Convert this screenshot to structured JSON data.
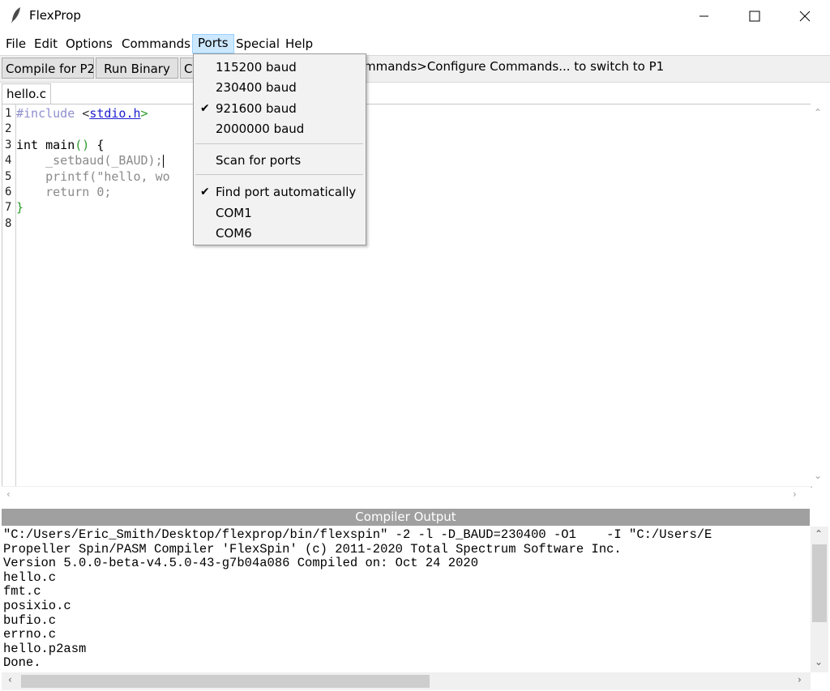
{
  "window": {
    "title": "FlexProp",
    "icon": "feather-icon",
    "controls": [
      "minimize-icon",
      "maximize-icon",
      "close-icon"
    ]
  },
  "menubar": {
    "items": [
      "File",
      "Edit",
      "Options",
      "Commands",
      "Ports",
      "Special",
      "Help"
    ],
    "active": "Ports"
  },
  "toolbar": {
    "compile_label": "Compile for P2",
    "run_label": "Run Binary",
    "third_label": "Co",
    "status": "mmands>Configure Commands... to switch to P1"
  },
  "tabs": [
    {
      "label": "hello.c"
    }
  ],
  "editor": {
    "line_numbers": [
      "1",
      "2",
      "3",
      "4",
      "5",
      "6",
      "7",
      "8"
    ],
    "lines": [
      {
        "a": "#include ",
        "b": "<",
        "c": "stdio.h",
        "d": ">"
      },
      {
        "text": ""
      },
      {
        "a": "int main",
        "b": "()",
        "c": " {"
      },
      {
        "text": "    _setbaud(_BAUD);"
      },
      {
        "text": "    printf(\"hello, wo"
      },
      {
        "text": "    return 0;"
      },
      {
        "text": "}"
      },
      {
        "text": ""
      }
    ]
  },
  "output": {
    "header": "Compiler Output",
    "lines": [
      "\"C:/Users/Eric_Smith/Desktop/flexprop/bin/flexspin\" -2 -l -D_BAUD=230400 -O1    -I \"C:/Users/E",
      "Propeller Spin/PASM Compiler 'FlexSpin' (c) 2011-2020 Total Spectrum Software Inc.",
      "Version 5.0.0-beta-v4.5.0-43-g7b04a086 Compiled on: Oct 24 2020",
      "hello.c",
      "fmt.c",
      "posixio.c",
      "bufio.c",
      "errno.c",
      "hello.p2asm",
      "Done."
    ]
  },
  "ports_menu": {
    "baud_items": [
      {
        "label": "115200 baud",
        "checked": false
      },
      {
        "label": "230400 baud",
        "checked": false
      },
      {
        "label": "921600 baud",
        "checked": true
      },
      {
        "label": "2000000 baud",
        "checked": false
      }
    ],
    "scan_label": "Scan for ports",
    "port_items": [
      {
        "label": "Find port automatically",
        "checked": true
      },
      {
        "label": "COM1",
        "checked": false
      },
      {
        "label": "COM6",
        "checked": false
      }
    ]
  }
}
